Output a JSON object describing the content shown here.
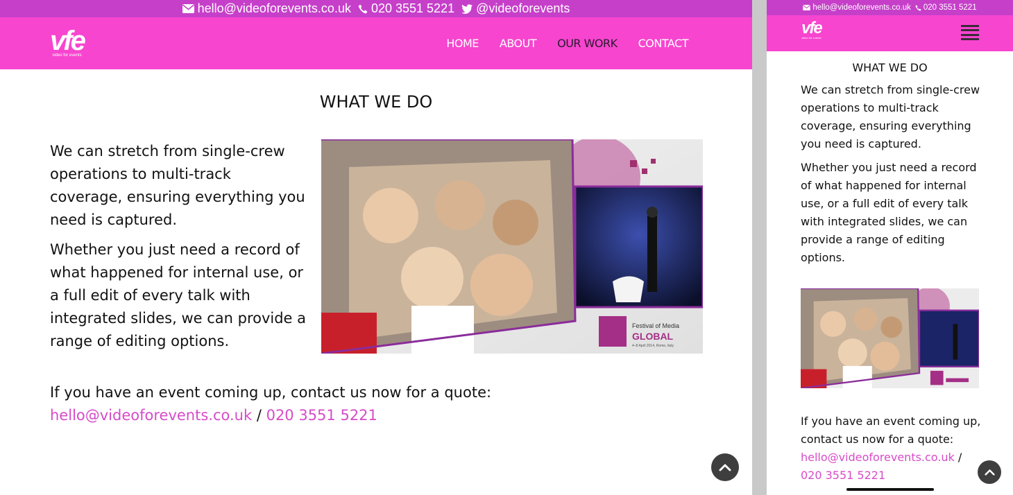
{
  "topbar": {
    "email": "hello@videoforevents.co.uk",
    "phone": "020 3551 5221",
    "twitter": "@videoforevents"
  },
  "logo": {
    "mark": "vfe",
    "sub": "video for events"
  },
  "nav": [
    {
      "label": "HOME"
    },
    {
      "label": "ABOUT"
    },
    {
      "label": "OUR WORK"
    },
    {
      "label": "CONTACT"
    }
  ],
  "main": {
    "heading": "WHAT WE DO",
    "paragraph1": "We can stretch from single-crew operations to multi-track coverage, ensuring everything you need is captured.",
    "paragraph2": "Whether you just need a record of what happened for internal use, or a full edit of every talk with integrated slides, we can provide a range of editing options.",
    "cta_text": "If you have an event coming up, contact us now for a quote:",
    "cta_email": "hello@videoforevents.co.uk",
    "cta_separator": "/",
    "cta_phone": "020 3551 5221"
  },
  "image": {
    "title_small": "Festival of Media",
    "title_big": "GLOBAL",
    "caption": "4–8 April 2014, Rome, Italy"
  },
  "colors": {
    "topbar": "#c63fc9",
    "navbar": "#f745cf",
    "link": "#d64bc9",
    "scroll_button": "#3e3e3e"
  },
  "icons": [
    "envelope-icon",
    "phone-icon",
    "twitter-icon",
    "chevron-up-icon",
    "hamburger-menu-icon"
  ]
}
